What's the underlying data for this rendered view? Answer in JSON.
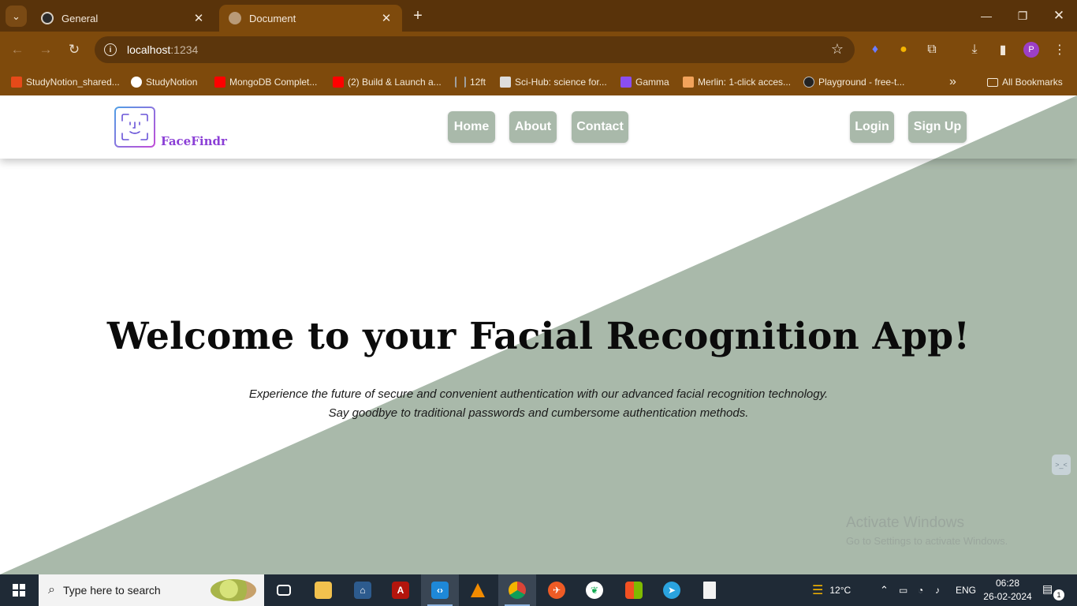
{
  "browser": {
    "tabs": [
      {
        "title": "General",
        "close": "✕"
      },
      {
        "title": "Document",
        "close": "✕"
      }
    ],
    "new_tab": "+",
    "url_host": "localhost",
    "url_port": ":1234",
    "profile_initial": "P",
    "bookmarks": [
      {
        "label": "StudyNotion_shared...",
        "color": "#e64a19"
      },
      {
        "label": "StudyNotion",
        "color": "#ffffff"
      },
      {
        "label": "MongoDB Complet...",
        "color": "#ff0000"
      },
      {
        "label": "(2) Build & Launch a...",
        "color": "#ff0000"
      },
      {
        "label": "12ft",
        "color": "#a0a0a0"
      },
      {
        "label": "Sci-Hub: science for...",
        "color": "#dddddd"
      },
      {
        "label": "Gamma",
        "color": "#8a4ef0"
      },
      {
        "label": "Merlin: 1-click acces...",
        "color": "#f2a35b"
      },
      {
        "label": "Playground - free-t...",
        "color": "#222222"
      }
    ],
    "more_bookmarks": "»",
    "all_bookmarks": "All Bookmarks"
  },
  "app": {
    "brand": "FaceFindr",
    "nav": [
      "Home",
      "About",
      "Contact"
    ],
    "auth": [
      "Login",
      "Sign Up"
    ],
    "hero_title": "Welcome to your Facial Recognition App!",
    "hero_line1": "Experience the future of secure and convenient authentication with our advanced facial recognition technology.",
    "hero_line2": "Say goodbye to traditional passwords and cumbersome authentication methods.",
    "colors": {
      "accent": "#a9b9aa",
      "brand": "#8b3fd6"
    }
  },
  "watermark": {
    "line1": "Activate Windows",
    "line2": "Go to Settings to activate Windows."
  },
  "taskbar": {
    "search_placeholder": "Type here to search",
    "weather": "12°C",
    "language": "ENG",
    "time": "06:28",
    "date": "26-02-2024",
    "notifications": "1"
  }
}
